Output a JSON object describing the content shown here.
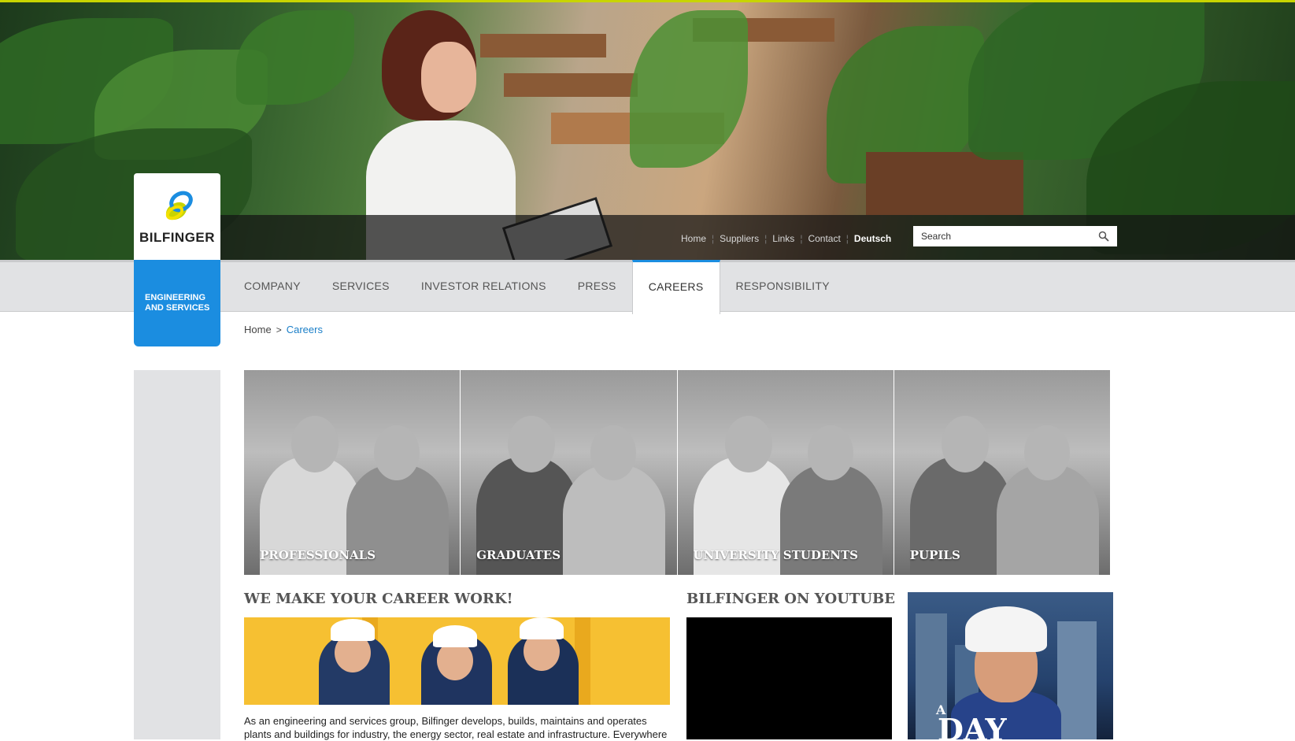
{
  "brand": {
    "name": "BILFINGER",
    "tagline_line1": "ENGINEERING",
    "tagline_line2": "AND SERVICES",
    "accent_color": "#1b8de0",
    "topline_color": "#c8d400"
  },
  "util_nav": {
    "links": [
      "Home",
      "Suppliers",
      "Links",
      "Contact"
    ],
    "language": "Deutsch"
  },
  "search": {
    "placeholder": "Search"
  },
  "main_nav": {
    "items": [
      "COMPANY",
      "SERVICES",
      "INVESTOR RELATIONS",
      "PRESS",
      "CAREERS",
      "RESPONSIBILITY"
    ],
    "active": "CAREERS"
  },
  "breadcrumb": {
    "home": "Home",
    "separator": ">",
    "current": "Careers"
  },
  "career_tiles": [
    "PROFESSIONALS",
    "GRADUATES",
    "UNIVERSITY STUDENTS",
    "PUPILS"
  ],
  "career_section": {
    "title": "WE MAKE YOUR CAREER WORK!",
    "text": "As an engineering and services group, Bilfinger develops, builds, maintains and operates plants and buildings for industry, the energy sector, real estate and infrastructure. Everywhere"
  },
  "youtube_section": {
    "title": "BILFINGER ON YOUTUBE"
  },
  "promo": {
    "word_a": "A",
    "word_day": "DAY"
  }
}
